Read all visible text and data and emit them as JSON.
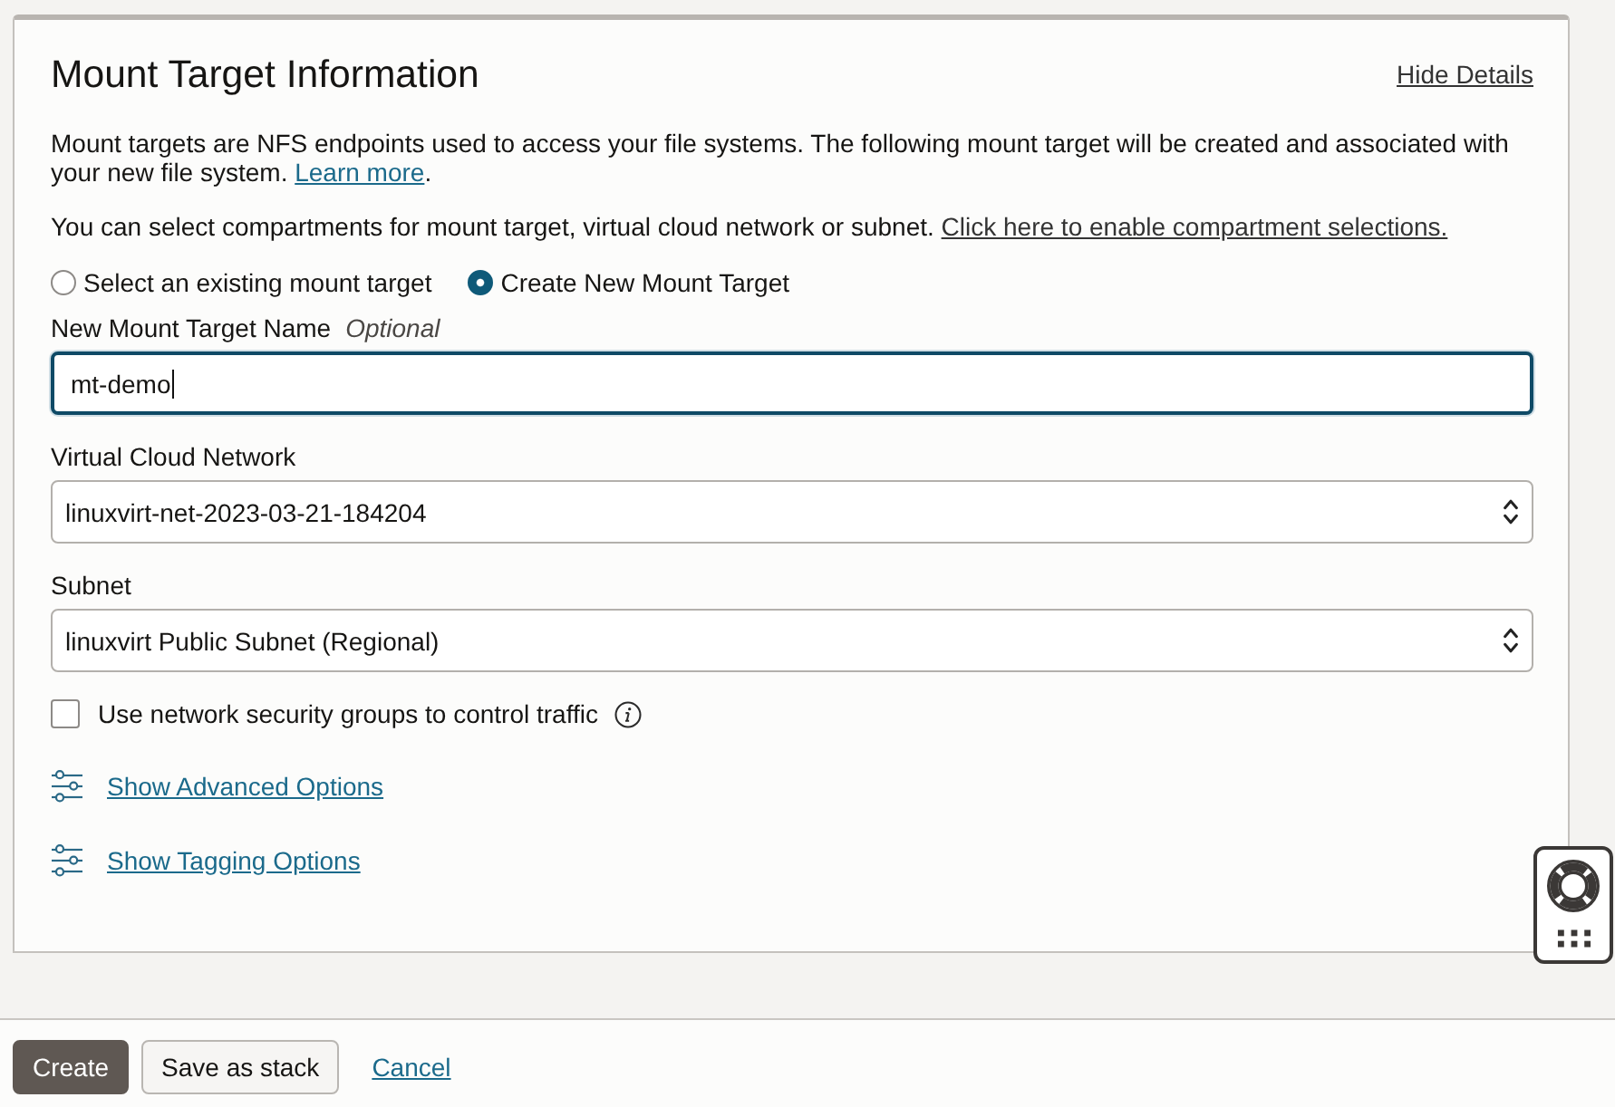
{
  "section": {
    "title": "Mount Target Information",
    "hide_link": "Hide Details"
  },
  "description": {
    "text": "Mount targets are NFS endpoints used to access your file systems. The following mount target will be created and associated with your new file system.",
    "link": "Learn more",
    "end": "."
  },
  "compartment_note": {
    "text": "You can select compartments for mount target, virtual cloud network or subnet.",
    "link": "Click here to enable compartment selections."
  },
  "mount_target_options": [
    {
      "label": "Select an existing mount target",
      "selected": false
    },
    {
      "label": "Create New Mount Target",
      "selected": true
    }
  ],
  "name_field": {
    "label": "New Mount Target Name",
    "hint": "Optional",
    "value": "mt-demo",
    "focused": true
  },
  "selects": [
    {
      "label": "Virtual Cloud Network",
      "value": "linuxvirt-net-2023-03-21-184204"
    },
    {
      "label": "Subnet",
      "value": "linuxvirt Public Subnet (Regional)"
    }
  ],
  "nsg_checkbox": {
    "label": "Use network security groups to control traffic",
    "checked": false
  },
  "option_links": [
    "Show Advanced Options",
    "Show Tagging Options"
  ],
  "footer": {
    "buttons": [
      {
        "label": "Create",
        "kind": "primary"
      },
      {
        "label": "Save as stack",
        "kind": "secondary"
      },
      {
        "label": "Cancel",
        "kind": "link"
      }
    ]
  }
}
